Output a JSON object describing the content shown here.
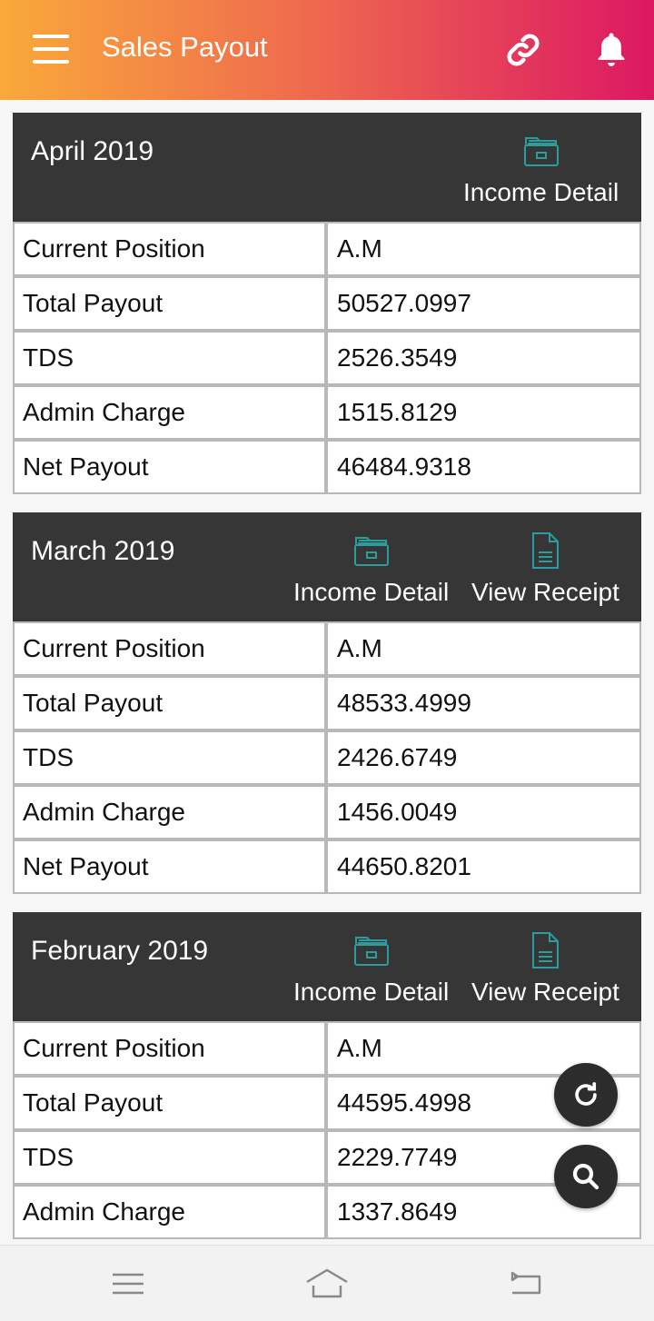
{
  "app_bar": {
    "title": "Sales Payout",
    "menu_icon": "hamburger-menu-icon",
    "link_icon": "link-icon",
    "bell_icon": "bell-icon",
    "gradient": [
      "#f9a93a",
      "#ef6d4d",
      "#dc1863"
    ]
  },
  "cards": [
    {
      "title": "April 2019",
      "actions": {
        "income_detail": "Income Detail"
      },
      "rows": [
        {
          "label": "Current Position",
          "value": "A.M"
        },
        {
          "label": "Total Payout",
          "value": "50527.0997"
        },
        {
          "label": "TDS",
          "value": "2526.3549"
        },
        {
          "label": "Admin Charge",
          "value": "1515.8129"
        },
        {
          "label": "Net Payout",
          "value": "46484.9318"
        }
      ]
    },
    {
      "title": "March 2019",
      "actions": {
        "income_detail": "Income Detail",
        "view_receipt": "View Receipt"
      },
      "rows": [
        {
          "label": "Current Position",
          "value": "A.M"
        },
        {
          "label": "Total Payout",
          "value": "48533.4999"
        },
        {
          "label": "TDS",
          "value": "2426.6749"
        },
        {
          "label": "Admin Charge",
          "value": "1456.0049"
        },
        {
          "label": "Net Payout",
          "value": "44650.8201"
        }
      ]
    },
    {
      "title": "February 2019",
      "actions": {
        "income_detail": "Income Detail",
        "view_receipt": "View Receipt"
      },
      "rows": [
        {
          "label": "Current Position",
          "value": "A.M"
        },
        {
          "label": "Total Payout",
          "value": "44595.4998"
        },
        {
          "label": "TDS",
          "value": "2229.7749"
        },
        {
          "label": "Admin Charge",
          "value": "1337.8649"
        }
      ]
    }
  ],
  "fabs": {
    "refresh_icon": "refresh-icon",
    "search_icon": "search-icon"
  },
  "system_nav": {
    "menu_icon": "recents-icon",
    "home_icon": "home-icon",
    "back_icon": "back-icon"
  },
  "colors": {
    "accent_teal": "#2a9d9f",
    "header_dark": "#363636"
  }
}
